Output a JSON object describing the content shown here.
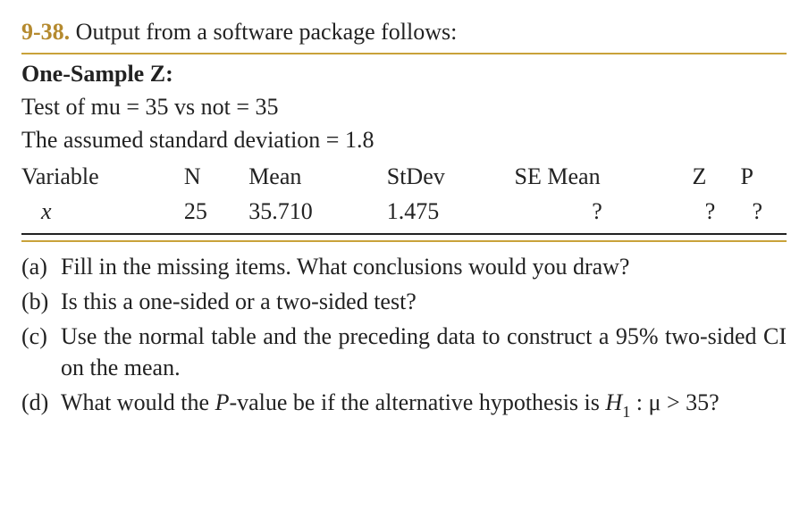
{
  "problem_number": "9-38.",
  "intro": "Output from a software package follows:",
  "output": {
    "title": "One-Sample Z:",
    "hypothesis_line": "Test of mu = 35 vs not = 35",
    "assumed_sd_line": "The assumed standard deviation = 1.8",
    "headers": {
      "variable": "Variable",
      "n": "N",
      "mean": "Mean",
      "stdev": "StDev",
      "se_mean": "SE Mean",
      "z": "Z",
      "p": "P"
    },
    "row": {
      "variable": "x",
      "n": "25",
      "mean": "35.710",
      "stdev": "1.475",
      "se_mean": "?",
      "z": "?",
      "p": "?"
    }
  },
  "questions": {
    "a": {
      "label": "(a)",
      "text": "Fill in the missing items. What conclusions would you draw?"
    },
    "b": {
      "label": "(b)",
      "text": "Is this a one-sided or a two-sided test?"
    },
    "c": {
      "label": "(c)",
      "text": "Use the normal table and the preceding data to construct a 95% two-sided CI on the mean."
    },
    "d": {
      "label": "(d)",
      "prefix": "What would the ",
      "pvalue_word": "P",
      "middle": "-value be if the alternative hypothesis is ",
      "hyp_H": "H",
      "hyp_sub": "1",
      "hyp_rest": " : μ > 35?"
    }
  }
}
